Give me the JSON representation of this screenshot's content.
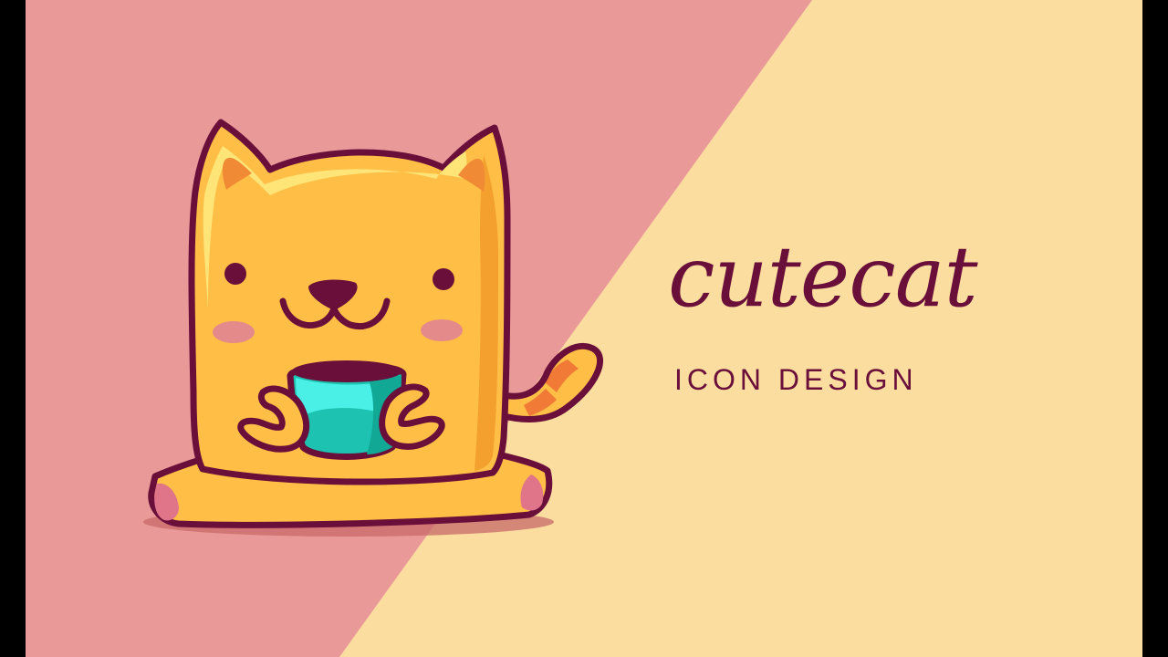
{
  "text": {
    "title": "cutecat",
    "subtitle": "ICON DESIGN"
  },
  "colors": {
    "background_left": "#ea9999",
    "background_right": "#fcdda0",
    "letterbox": "#000000",
    "outline": "#6a0f3a",
    "cat_body": "#ffbe45",
    "cat_shade": "#f3a02f",
    "cat_highlight": "#ffe478",
    "ear_inner": "#f08a34",
    "blush": "#e58a8a",
    "cup": "#1dc3b0",
    "cup_light": "#4af0e6",
    "paw_pads": "#e0758a",
    "shadow": "#c86a6a",
    "tail_stripe": "#f07a36"
  },
  "icons": [
    "cat-illustration",
    "cup"
  ]
}
